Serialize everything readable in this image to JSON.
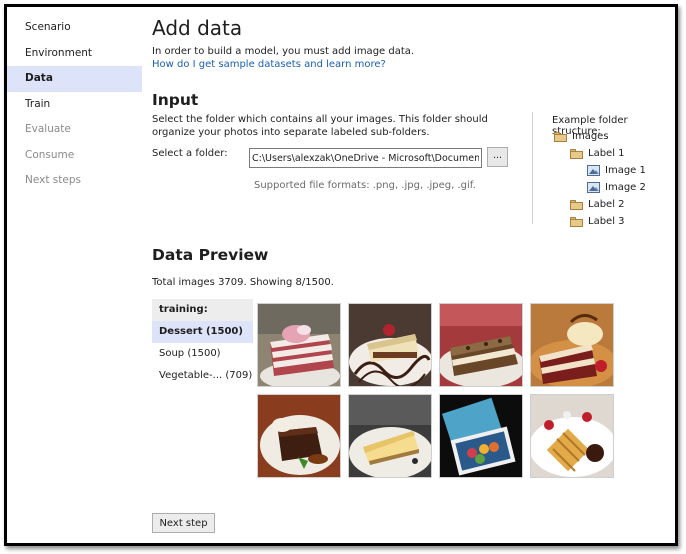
{
  "sidebar": {
    "items": [
      {
        "label": "Scenario",
        "state": "normal"
      },
      {
        "label": "Environment",
        "state": "normal"
      },
      {
        "label": "Data",
        "state": "active"
      },
      {
        "label": "Train",
        "state": "normal"
      },
      {
        "label": "Evaluate",
        "state": "disabled"
      },
      {
        "label": "Consume",
        "state": "disabled"
      },
      {
        "label": "Next steps",
        "state": "disabled"
      }
    ]
  },
  "header": {
    "title": "Add data",
    "intro": "In order to build a model, you must add image data.",
    "help_link": "How do I get sample datasets and learn more?"
  },
  "input": {
    "heading": "Input",
    "description": "Select the folder which contains all your images. This folder should organize your photos into separate labeled sub-folders.",
    "folder_label": "Select a folder:",
    "folder_value": "C:\\Users\\alexzak\\OneDrive - Microsoft\\Documents\\",
    "browse_label": "...",
    "formats": "Supported file formats: .png, .jpg, .jpeg, .gif."
  },
  "example": {
    "title": "Example folder structure:",
    "tree": [
      {
        "label": "Images",
        "icon": "folder-icon"
      },
      {
        "label": "Label 1",
        "icon": "folder-icon"
      },
      {
        "label": "Image 1",
        "icon": "image-icon"
      },
      {
        "label": "Image 2",
        "icon": "image-icon"
      },
      {
        "label": "Label 2",
        "icon": "folder-icon"
      },
      {
        "label": "Label 3",
        "icon": "folder-icon"
      }
    ]
  },
  "preview": {
    "heading": "Data Preview",
    "total": "Total images 3709. Showing 8/1500.",
    "group_header": "training:",
    "labels": [
      {
        "label": "Dessert (1500)",
        "selected": true
      },
      {
        "label": "Soup (1500)",
        "selected": false
      },
      {
        "label": "Vegetable-... (709)",
        "selected": false
      }
    ],
    "thumbnails": [
      {
        "name": "layered-cake-slice"
      },
      {
        "name": "cheesecake-chocolate-drizzle"
      },
      {
        "name": "tiramisu-slice"
      },
      {
        "name": "red-velvet-cake"
      },
      {
        "name": "chocolate-brownie"
      },
      {
        "name": "cheesecake-on-plate"
      },
      {
        "name": "macarons-photo"
      },
      {
        "name": "waffle-with-fruit"
      }
    ]
  },
  "footer": {
    "next_label": "Next step"
  }
}
